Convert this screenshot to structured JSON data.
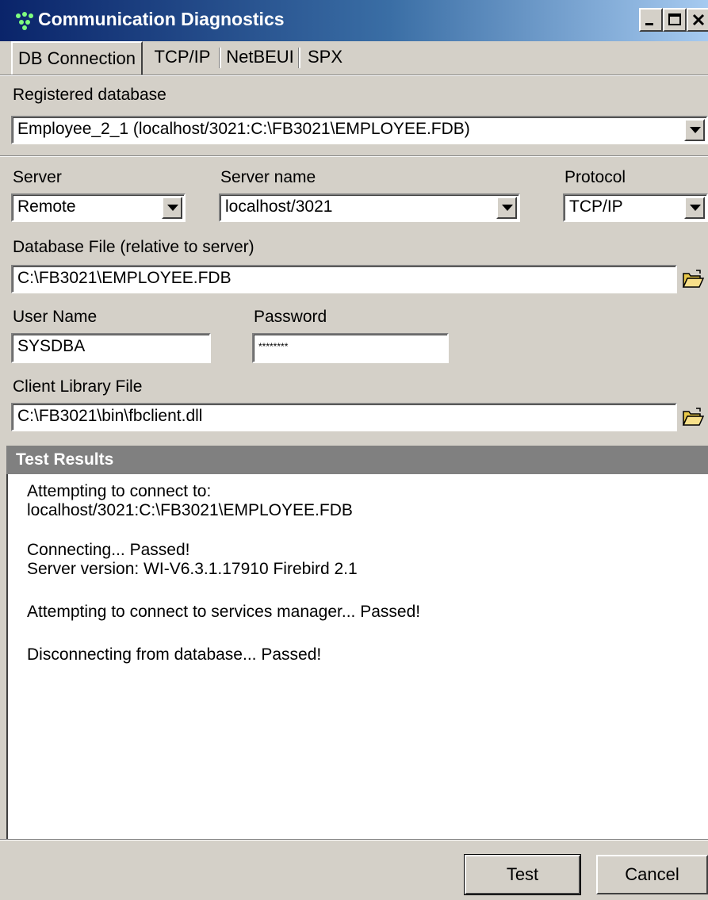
{
  "window": {
    "title": "Communication Diagnostics"
  },
  "tabs": [
    {
      "label": "DB Connection",
      "active": true
    },
    {
      "label": "TCP/IP",
      "active": false
    },
    {
      "label": "NetBEUI",
      "active": false
    },
    {
      "label": "SPX",
      "active": false
    }
  ],
  "registered_database": {
    "label": "Registered database",
    "value": "Employee_2_1 (localhost/3021:C:\\FB3021\\EMPLOYEE.FDB)"
  },
  "server": {
    "label": "Server",
    "value": "Remote"
  },
  "server_name": {
    "label": "Server name",
    "value": "localhost/3021"
  },
  "protocol": {
    "label": "Protocol",
    "value": "TCP/IP"
  },
  "database_file": {
    "label": "Database File (relative to server)",
    "value": "C:\\FB3021\\EMPLOYEE.FDB"
  },
  "user_name": {
    "label": "User Name",
    "value": "SYSDBA"
  },
  "password": {
    "label": "Password",
    "value": "********"
  },
  "client_library": {
    "label": "Client Library File",
    "value": "C:\\FB3021\\bin\\fbclient.dll"
  },
  "results": {
    "header": "Test Results",
    "lines": [
      "Attempting to connect to:",
      "localhost/3021:C:\\FB3021\\EMPLOYEE.FDB",
      "Connecting... Passed!",
      "Server version: WI-V6.3.1.17910 Firebird 2.1",
      "Attempting to connect to services manager... Passed!",
      "Disconnecting from database... Passed!"
    ]
  },
  "buttons": {
    "test": "Test",
    "cancel": "Cancel"
  },
  "colors": {
    "title_bar_start": "#0a246a",
    "title_bar_end": "#a6caf0",
    "window_face": "#d4d0c8",
    "results_header": "#808080"
  }
}
